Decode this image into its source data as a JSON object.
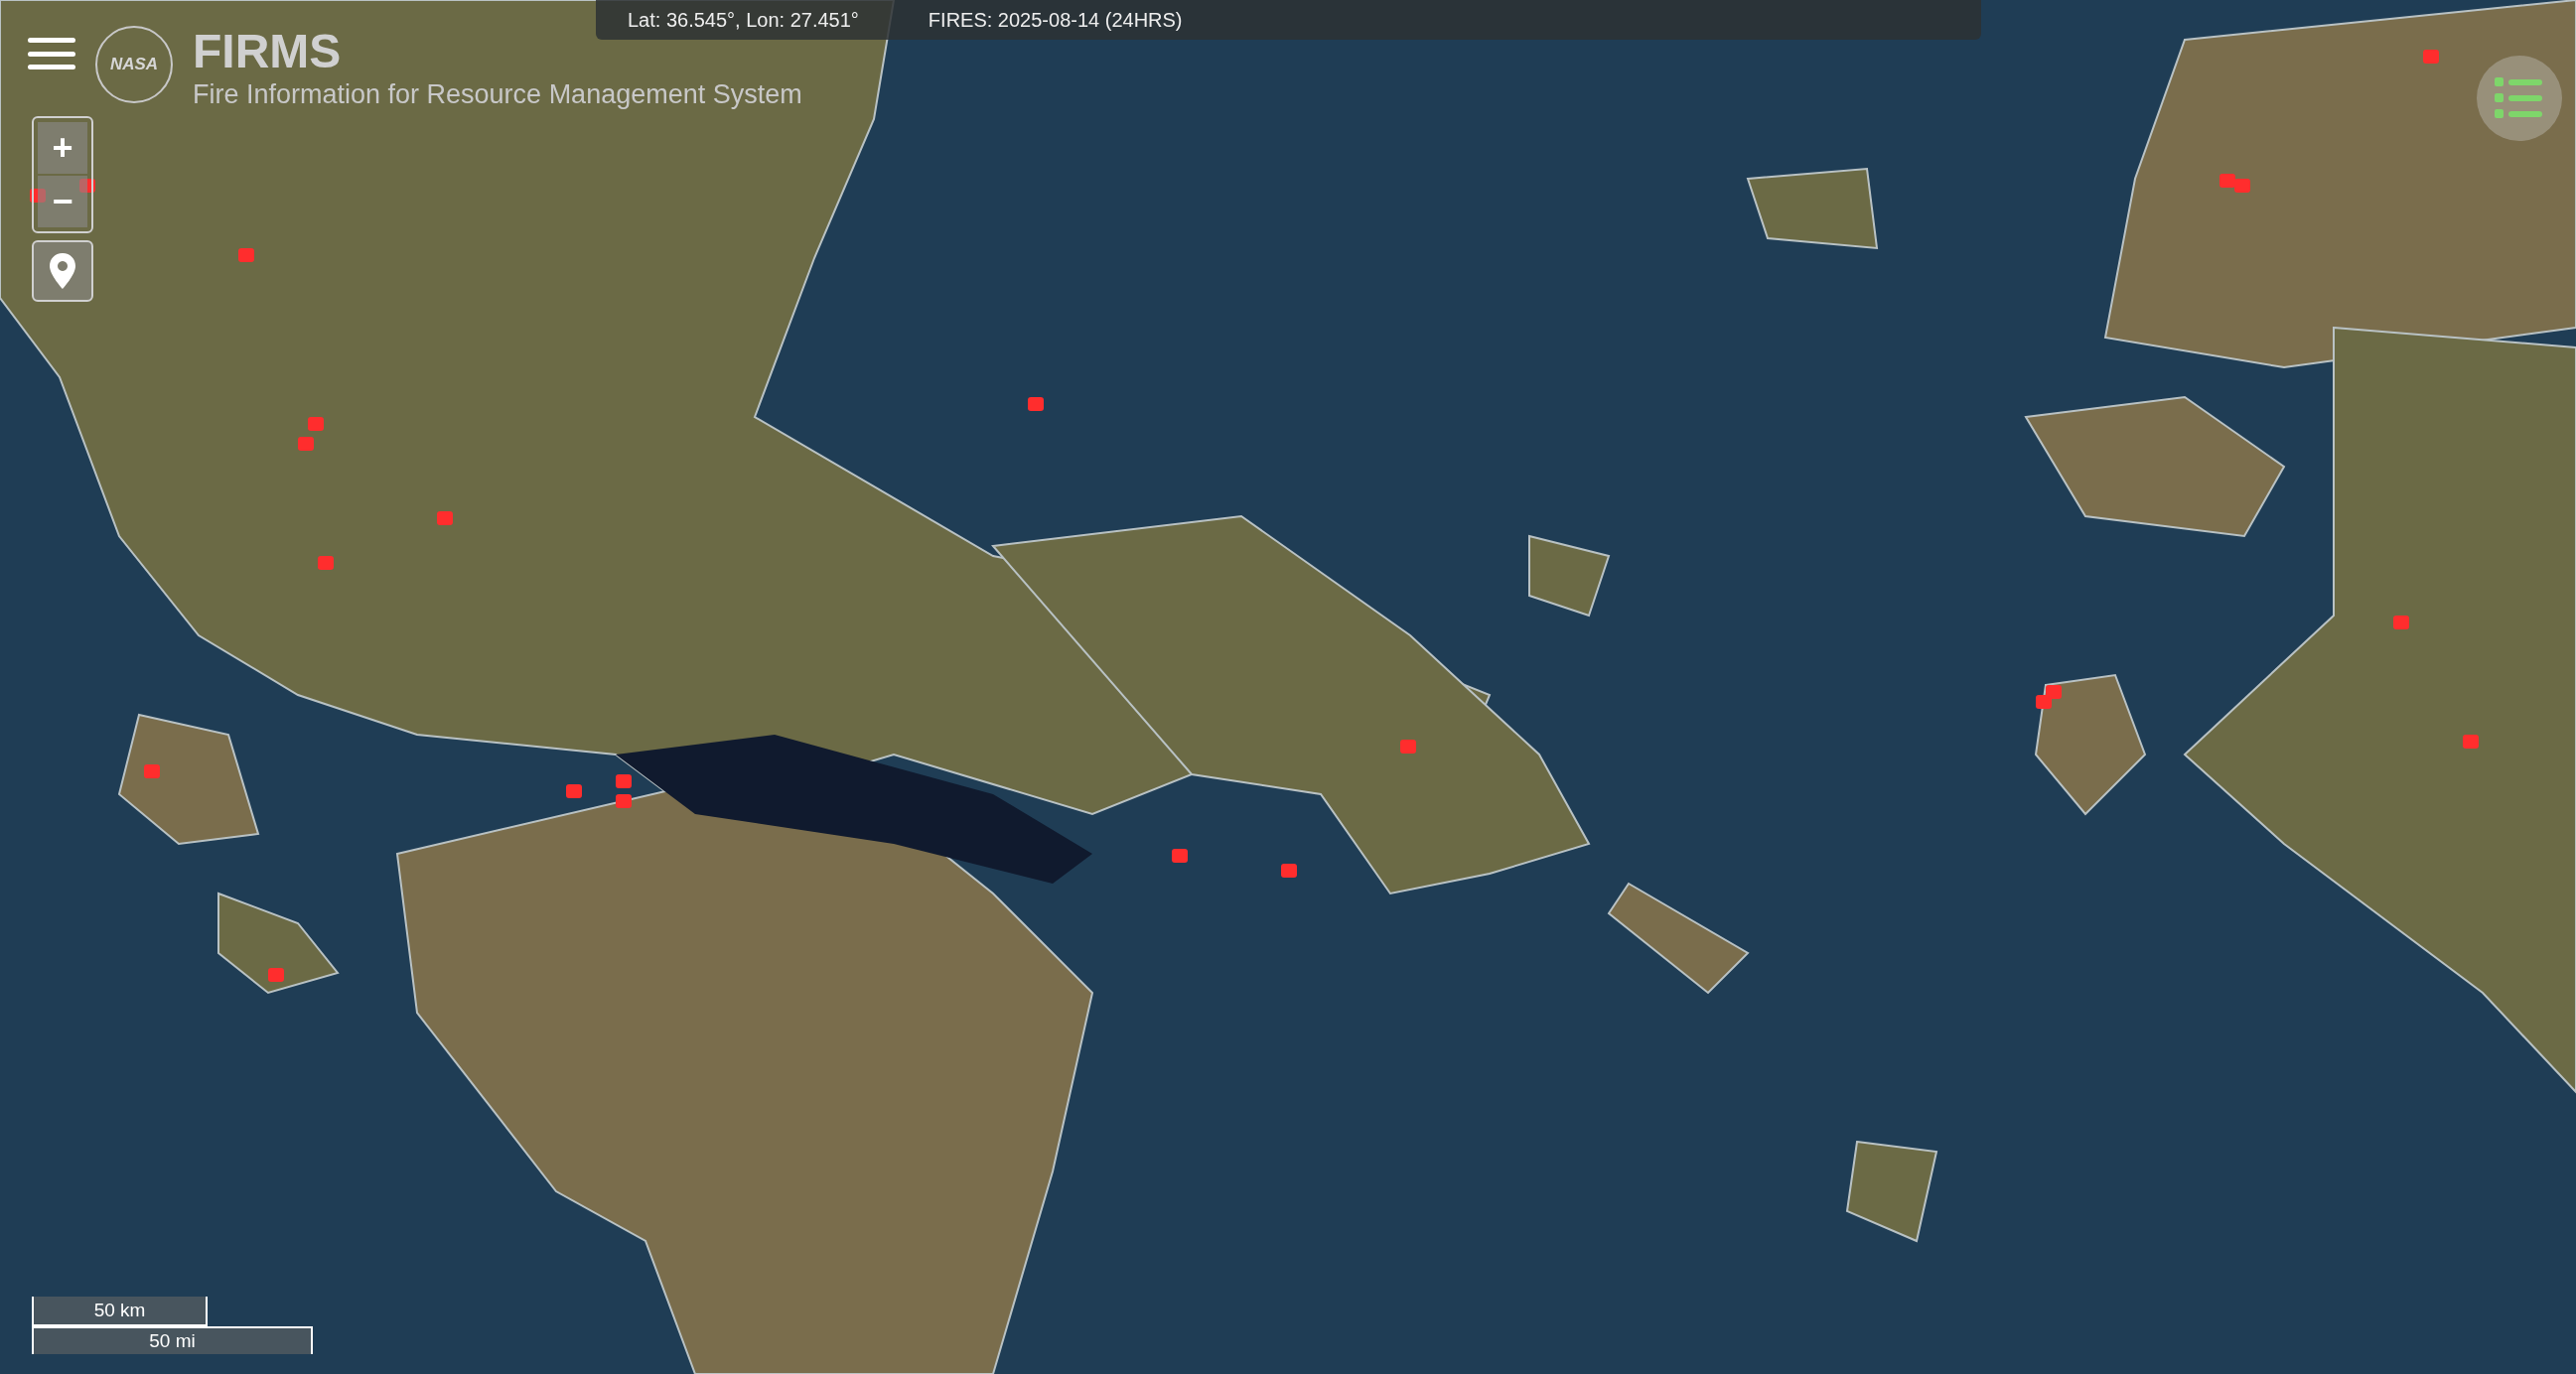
{
  "header": {
    "title": "FIRMS",
    "subtitle": "Fire Information for Resource Management System",
    "logo_text": "NASA"
  },
  "status_bar": {
    "coordinates": "Lat: 36.545°, Lon: 27.451°",
    "fires": "FIRES: 2025-08-14 (24HRS)"
  },
  "map_controls": {
    "zoom_in": "+",
    "zoom_out": "−"
  },
  "scale": {
    "metric": "50 km",
    "imperial": "50 mi"
  }
}
